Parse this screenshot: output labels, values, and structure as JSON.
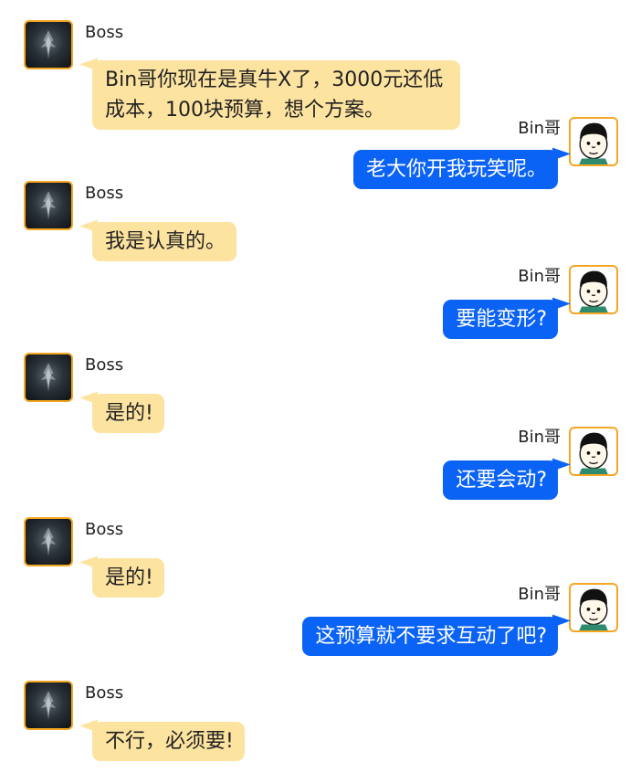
{
  "colors": {
    "boss_bubble": "#fde3a0",
    "bin_bubble": "#0b63f6",
    "avatar_border": "#f5a623"
  },
  "icons": {
    "boss_avatar": "dark-emblem-avatar-icon",
    "bin_avatar": "meme-face-avatar-icon"
  },
  "messages": [
    {
      "sender": "Boss",
      "text": "Bin哥你现在是真牛X了，3000元还低成本，100块预算，想个方案。"
    },
    {
      "sender": "Bin哥",
      "text": "老大你开我玩笑呢。"
    },
    {
      "sender": "Boss",
      "text": "我是认真的。"
    },
    {
      "sender": "Bin哥",
      "text": "要能变形?"
    },
    {
      "sender": "Boss",
      "text": "是的!"
    },
    {
      "sender": "Bin哥",
      "text": "还要会动?"
    },
    {
      "sender": "Boss",
      "text": "是的!"
    },
    {
      "sender": "Bin哥",
      "text": "这预算就不要求互动了吧?"
    },
    {
      "sender": "Boss",
      "text": "不行，必须要!"
    }
  ]
}
